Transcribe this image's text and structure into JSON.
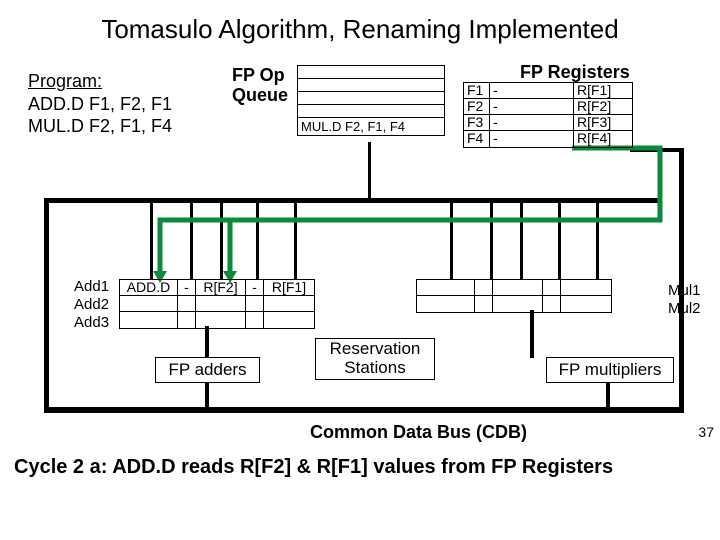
{
  "title": "Tomasulo Algorithm, Renaming Implemented",
  "program": {
    "header": "Program:",
    "lines": [
      "ADD.D  F1, F2, F1",
      "MUL.D  F2, F1, F4"
    ]
  },
  "opqueue": {
    "label": "FP Op\nQueue",
    "rows": [
      "",
      "",
      "",
      "",
      "MUL.D F2, F1, F4"
    ]
  },
  "fp_registers": {
    "title": "FP Registers",
    "rows": [
      {
        "name": "F1",
        "tag": "-",
        "val": "R[F1]"
      },
      {
        "name": "F2",
        "tag": "-",
        "val": "R[F2]"
      },
      {
        "name": "F3",
        "tag": "-",
        "val": "R[F3]"
      },
      {
        "name": "F4",
        "tag": "-",
        "val": "R[F4]"
      }
    ]
  },
  "add_rs": {
    "labels": [
      "Add1",
      "Add2",
      "Add3"
    ],
    "rows": [
      {
        "op": "ADD.D",
        "t1": "-",
        "v1": "R[F2]",
        "t2": "-",
        "v2": "R[F1]"
      },
      {
        "op": "",
        "t1": "",
        "v1": "",
        "t2": "",
        "v2": ""
      },
      {
        "op": "",
        "t1": "",
        "v1": "",
        "t2": "",
        "v2": ""
      }
    ]
  },
  "mul_rs": {
    "labels": [
      "Mul1",
      "Mul2"
    ],
    "rows": [
      {
        "op": "",
        "t1": "",
        "v1": "",
        "t2": "",
        "v2": ""
      },
      {
        "op": "",
        "t1": "",
        "v1": "",
        "t2": "",
        "v2": ""
      }
    ]
  },
  "units": {
    "fpadders": "FP adders",
    "reservation": "Reservation Stations",
    "fpmultipliers": "FP multipliers"
  },
  "cdb_label": "Common Data Bus (CDB)",
  "page_num": "37",
  "cycle_text": "Cycle 2 a:  ADD.D reads R[F2] & R[F1] values from FP Registers"
}
